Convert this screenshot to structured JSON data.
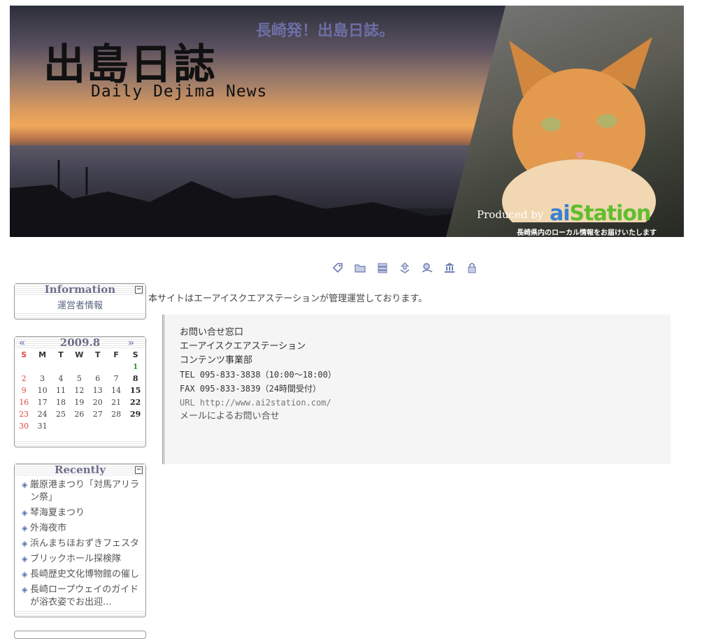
{
  "banner": {
    "logo_jp": "出島日誌",
    "logo_en": "Daily Dejima News",
    "tagline": "長崎発！出島日誌。",
    "produced_by": "Produced by",
    "brand_a": "ai",
    "brand_b": "Station",
    "brand_sub": "長崎県内のローカル情報をお届けいたします"
  },
  "toolbar": {
    "icons": [
      "tag-icon",
      "folder-icon",
      "book-icon",
      "sync-icon",
      "search-icon",
      "bank-icon",
      "lock-icon"
    ]
  },
  "info_box": {
    "title": "Information",
    "link": "運営者情報"
  },
  "calendar": {
    "title": "2009.8",
    "prev": "«",
    "next": "»",
    "weekdays": [
      "S",
      "M",
      "T",
      "W",
      "T",
      "F",
      "S"
    ],
    "weeks": [
      [
        "",
        "",
        "",
        "",
        "",
        "",
        "1"
      ],
      [
        "2",
        "3",
        "4",
        "5",
        "6",
        "7",
        "8"
      ],
      [
        "9",
        "10",
        "11",
        "12",
        "13",
        "14",
        "15"
      ],
      [
        "16",
        "17",
        "18",
        "19",
        "20",
        "21",
        "22"
      ],
      [
        "23",
        "24",
        "25",
        "26",
        "27",
        "28",
        "29"
      ],
      [
        "30",
        "31",
        "",
        "",
        "",
        "",
        ""
      ]
    ]
  },
  "recent_box": {
    "title": "Recently",
    "items": [
      "厳原港まつり「対馬アリラン祭」",
      "琴海夏まつり",
      "外海夜市",
      "浜んまちほおずきフェスタ",
      "ブリックホール探検隊",
      "長崎歴史文化博物館の催し",
      "長崎ロープウェイのガイドが浴衣姿でお出迎..."
    ]
  },
  "main": {
    "intro": "本サイトはエーアイスクエアステーションが管理運営しております。",
    "contact": {
      "heading": "お問い合せ窓口",
      "company": "エーアイスクエアステーション",
      "dept": "コンテンツ事業部",
      "tel": "TEL 095-833-3838（10:00～18:00）",
      "fax": "FAX 095-833-3839（24時間受付）",
      "url": "URL http://www.ai2station.com/",
      "mail": "メールによるお問い合せ"
    }
  }
}
